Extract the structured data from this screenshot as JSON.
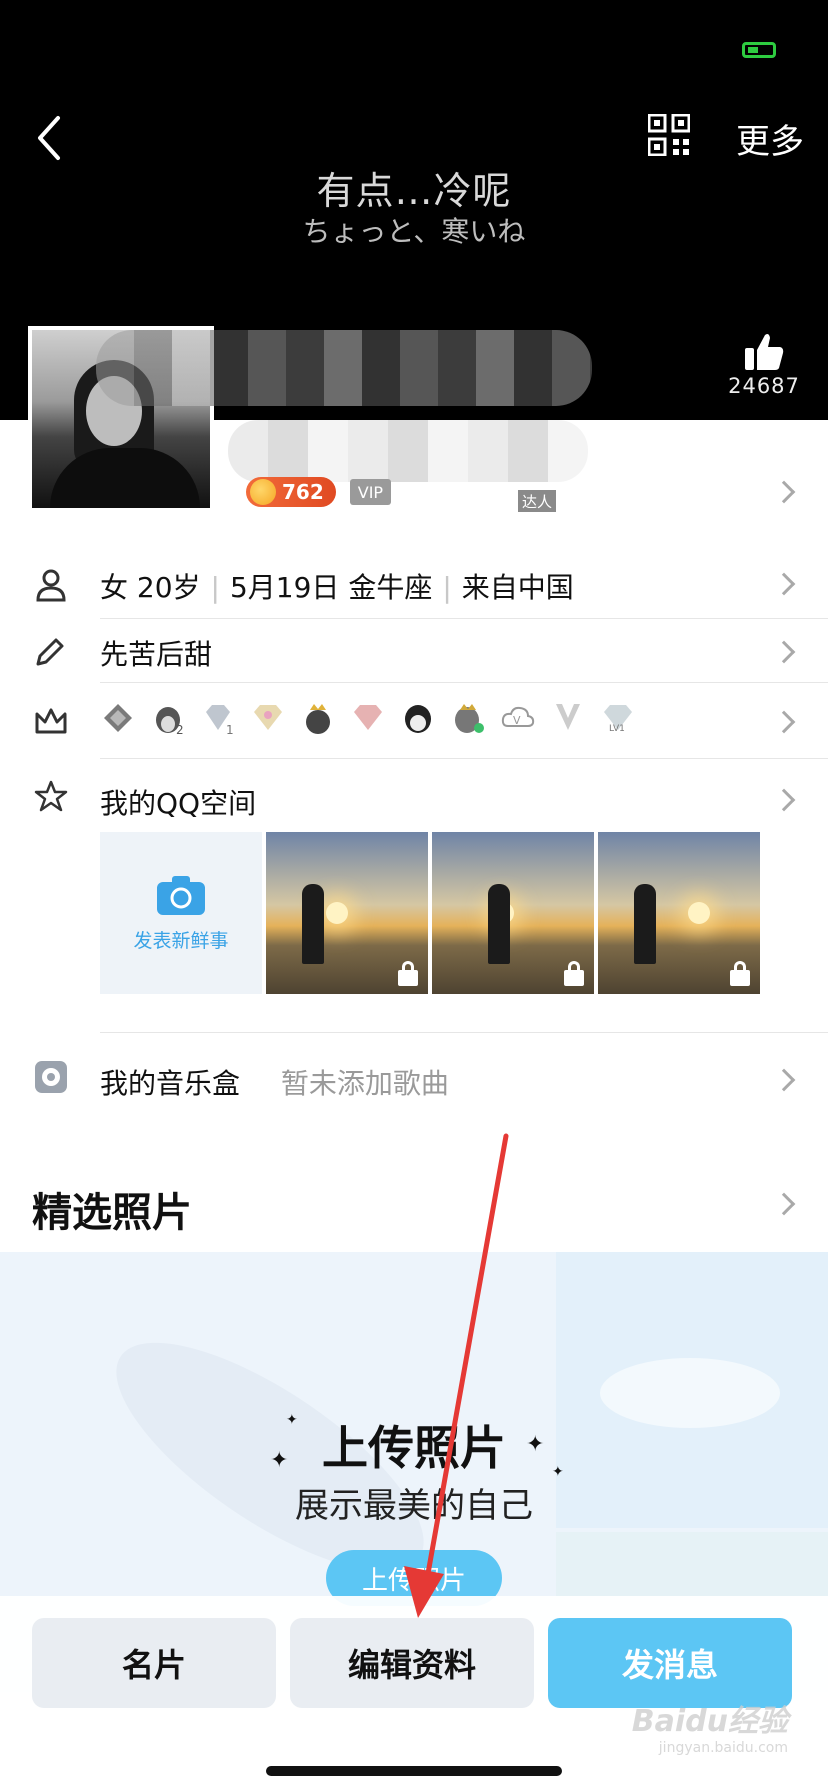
{
  "header": {
    "cover_line1": "有点…冷呢",
    "cover_line2": "ちょっと、寒いね",
    "more_label": "更多",
    "likes": "24687"
  },
  "profile": {
    "coin_level": "762",
    "badge_tag": "达人"
  },
  "info": {
    "gender_age": "女 20岁",
    "birthday": "5月19日 金牛座",
    "location": "来自中国",
    "signature": "先苦后甜"
  },
  "qzone": {
    "title": "我的QQ空间",
    "post_label": "发表新鲜事"
  },
  "music": {
    "title": "我的音乐盒",
    "status": "暂未添加歌曲"
  },
  "featured": {
    "title": "精选照片",
    "upload_title": "上传照片",
    "upload_subtitle": "展示最美的自己",
    "upload_button": "上传照片"
  },
  "actions": {
    "card": "名片",
    "edit": "编辑资料",
    "message": "发消息"
  },
  "watermark": {
    "brand": "Baidu经验",
    "domain": "jingyan.baidu.com"
  },
  "icons": [
    "back-icon",
    "qr-code-icon",
    "thumbs-up-icon",
    "person-icon",
    "pencil-icon",
    "crown-icon",
    "star-icon",
    "camera-icon",
    "lock-icon",
    "music-icon",
    "chevron-right-icon"
  ],
  "colors": {
    "accent": "#5cc6f4",
    "coin_badge": "#e04a22",
    "annotation_arrow": "#e53935"
  }
}
